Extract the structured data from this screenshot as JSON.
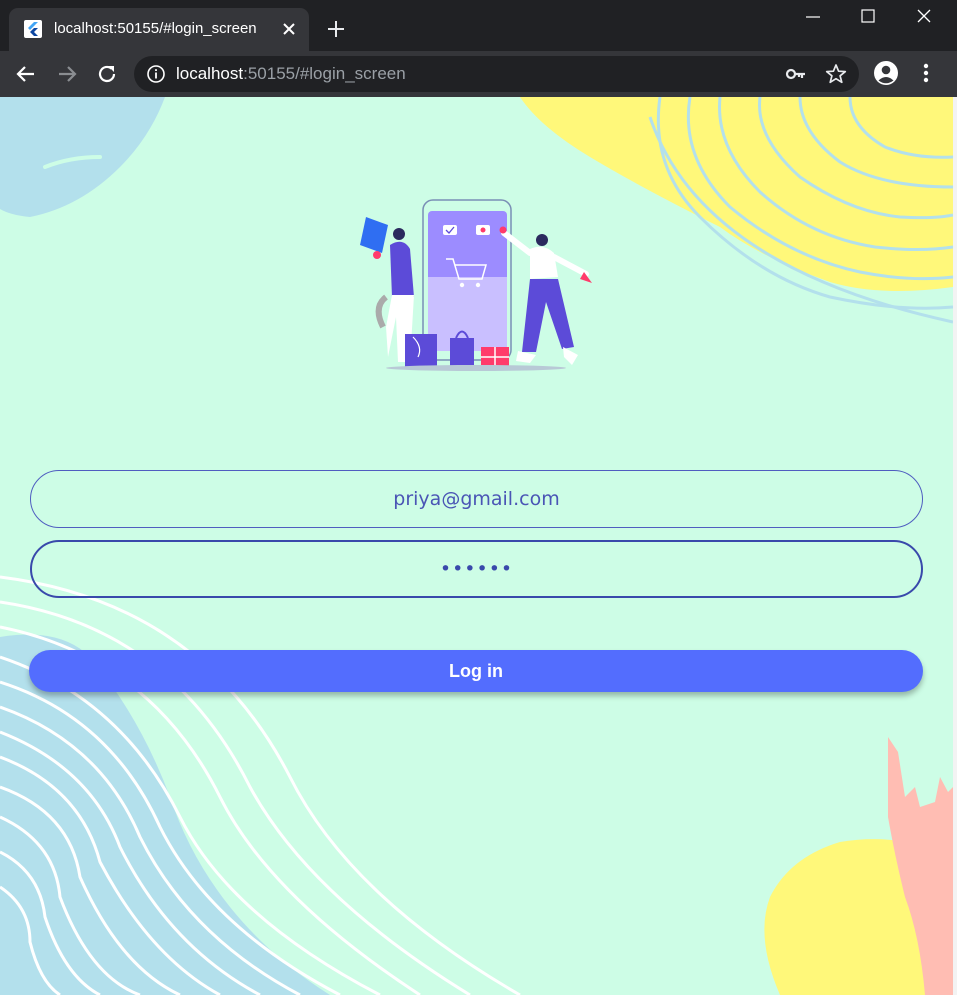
{
  "browser": {
    "tab": {
      "title": "localhost:50155/#login_screen",
      "favicon": "flutter-icon"
    },
    "address_bar": {
      "host": "localhost",
      "rest": ":50155/#login_screen"
    },
    "icons": [
      "back-arrow-icon",
      "forward-arrow-icon",
      "reload-icon",
      "info-icon",
      "key-icon",
      "star-icon",
      "profile-icon",
      "more-menu-icon"
    ]
  },
  "login": {
    "email_value": "priya@gmail.com",
    "password_value": "••••••",
    "button_label": "Log in"
  },
  "colors": {
    "background": "#cdfde6",
    "accent": "#536dfe",
    "field_border": "#3949ab",
    "blob_yellow": "#fff87a",
    "blob_blue": "#b3e0ec",
    "blob_pink": "#ffbdb3"
  }
}
